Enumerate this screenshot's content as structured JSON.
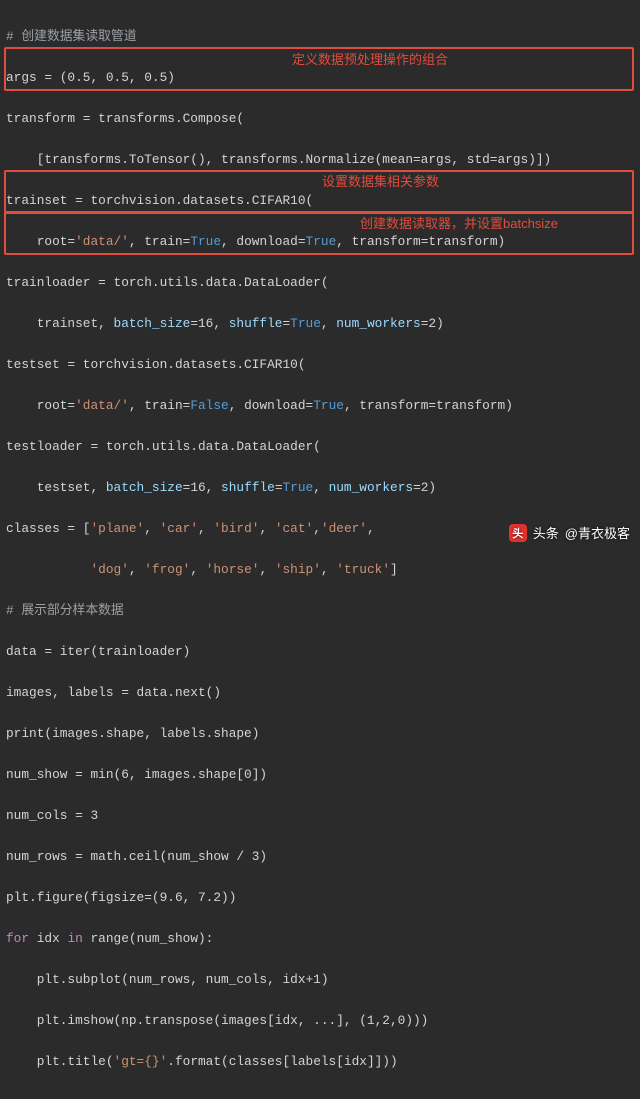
{
  "code": {
    "comment_pipeline": "# 创建数据集读取管道",
    "l_args": "args = (0.5, 0.5, 0.5)",
    "l_transform1_a": "transform = transforms.Compose(",
    "l_transform2": "    [transforms.ToTensor(), transforms.Normalize(mean=args, std=args)])",
    "l_trainset1": "trainset = torchvision.datasets.CIFAR10(",
    "l_trainset2_pre": "    root=",
    "l_trainset2_root": "'data/'",
    "l_trainset2_mid1": ", train=",
    "l_trainset2_true1": "True",
    "l_trainset2_mid2": ", download=",
    "l_trainset2_true2": "True",
    "l_trainset2_mid3": ", transform=transform)",
    "l_trainloader1": "trainloader = torch.utils.data.DataLoader(",
    "l_trainloader2_pre": "    trainset, ",
    "l_trainloader2_bs": "batch_size",
    "l_trainloader2_eq": "=16, ",
    "l_trainloader2_sh": "shuffle",
    "l_trainloader2_eqT": "=",
    "l_trainloader2_true": "True",
    "l_trainloader2_nw": ", ",
    "l_trainloader2_nwk": "num_workers",
    "l_trainloader2_end": "=2)",
    "l_testset1": "testset = torchvision.datasets.CIFAR10(",
    "l_testset2_pre": "    root=",
    "l_testset2_root": "'data/'",
    "l_testset2_mid1": ", train=",
    "l_testset2_false": "False",
    "l_testset2_mid2": ", download=",
    "l_testset2_true": "True",
    "l_testset2_mid3": ", transform=transform)",
    "l_testloader1": "testloader = torch.utils.data.DataLoader(",
    "l_testloader2_pre": "    testset, ",
    "l_testloader2_bs": "batch_size",
    "l_testloader2_eq": "=16, ",
    "l_testloader2_sh": "shuffle",
    "l_testloader2_eqT": "=",
    "l_testloader2_true": "True",
    "l_testloader2_nw": ", ",
    "l_testloader2_nwk": "num_workers",
    "l_testloader2_end": "=2)",
    "l_classes1": "classes = ['plane', 'car', 'bird', 'cat','deer',",
    "l_classes2": "           'dog', 'frog', 'horse', 'ship', 'truck']",
    "comment_show": "# 展示部分样本数据",
    "l_data": "data = iter(trainloader)",
    "l_imglbl": "images, labels = data.next()",
    "l_print": "print(images.shape, labels.shape)",
    "l_numshow": "num_show = min(6, images.shape[0])",
    "l_numcols": "num_cols = 3",
    "l_numrows": "num_rows = math.ceil(num_show / 3)",
    "l_fig": "plt.figure(figsize=(9.6, 7.2))",
    "l_for_pre": "for",
    "l_for_mid": " idx ",
    "l_for_in": "in",
    "l_for_post": " range(num_show):",
    "l_subplot": "    plt.subplot(num_rows, num_cols, idx+1)",
    "l_imshow": "    plt.imshow(np.transpose(images[idx, ...], (1,2,0)))",
    "l_title_a": "    plt.title(",
    "l_title_str": "'gt={}'",
    "l_title_b": ".format(classes[labels[idx]]))"
  },
  "annotations": {
    "a1": "定义数据预处理操作的组合",
    "a2": "设置数据集相关参数",
    "a3": "创建数据读取器，并设置batchsize"
  },
  "watermark": {
    "prefix": "头条",
    "handle": "@青衣极客",
    "logo_glyph": "头"
  },
  "colors": {
    "annotation": "#e04c3e",
    "background": "#2b2b2b"
  }
}
